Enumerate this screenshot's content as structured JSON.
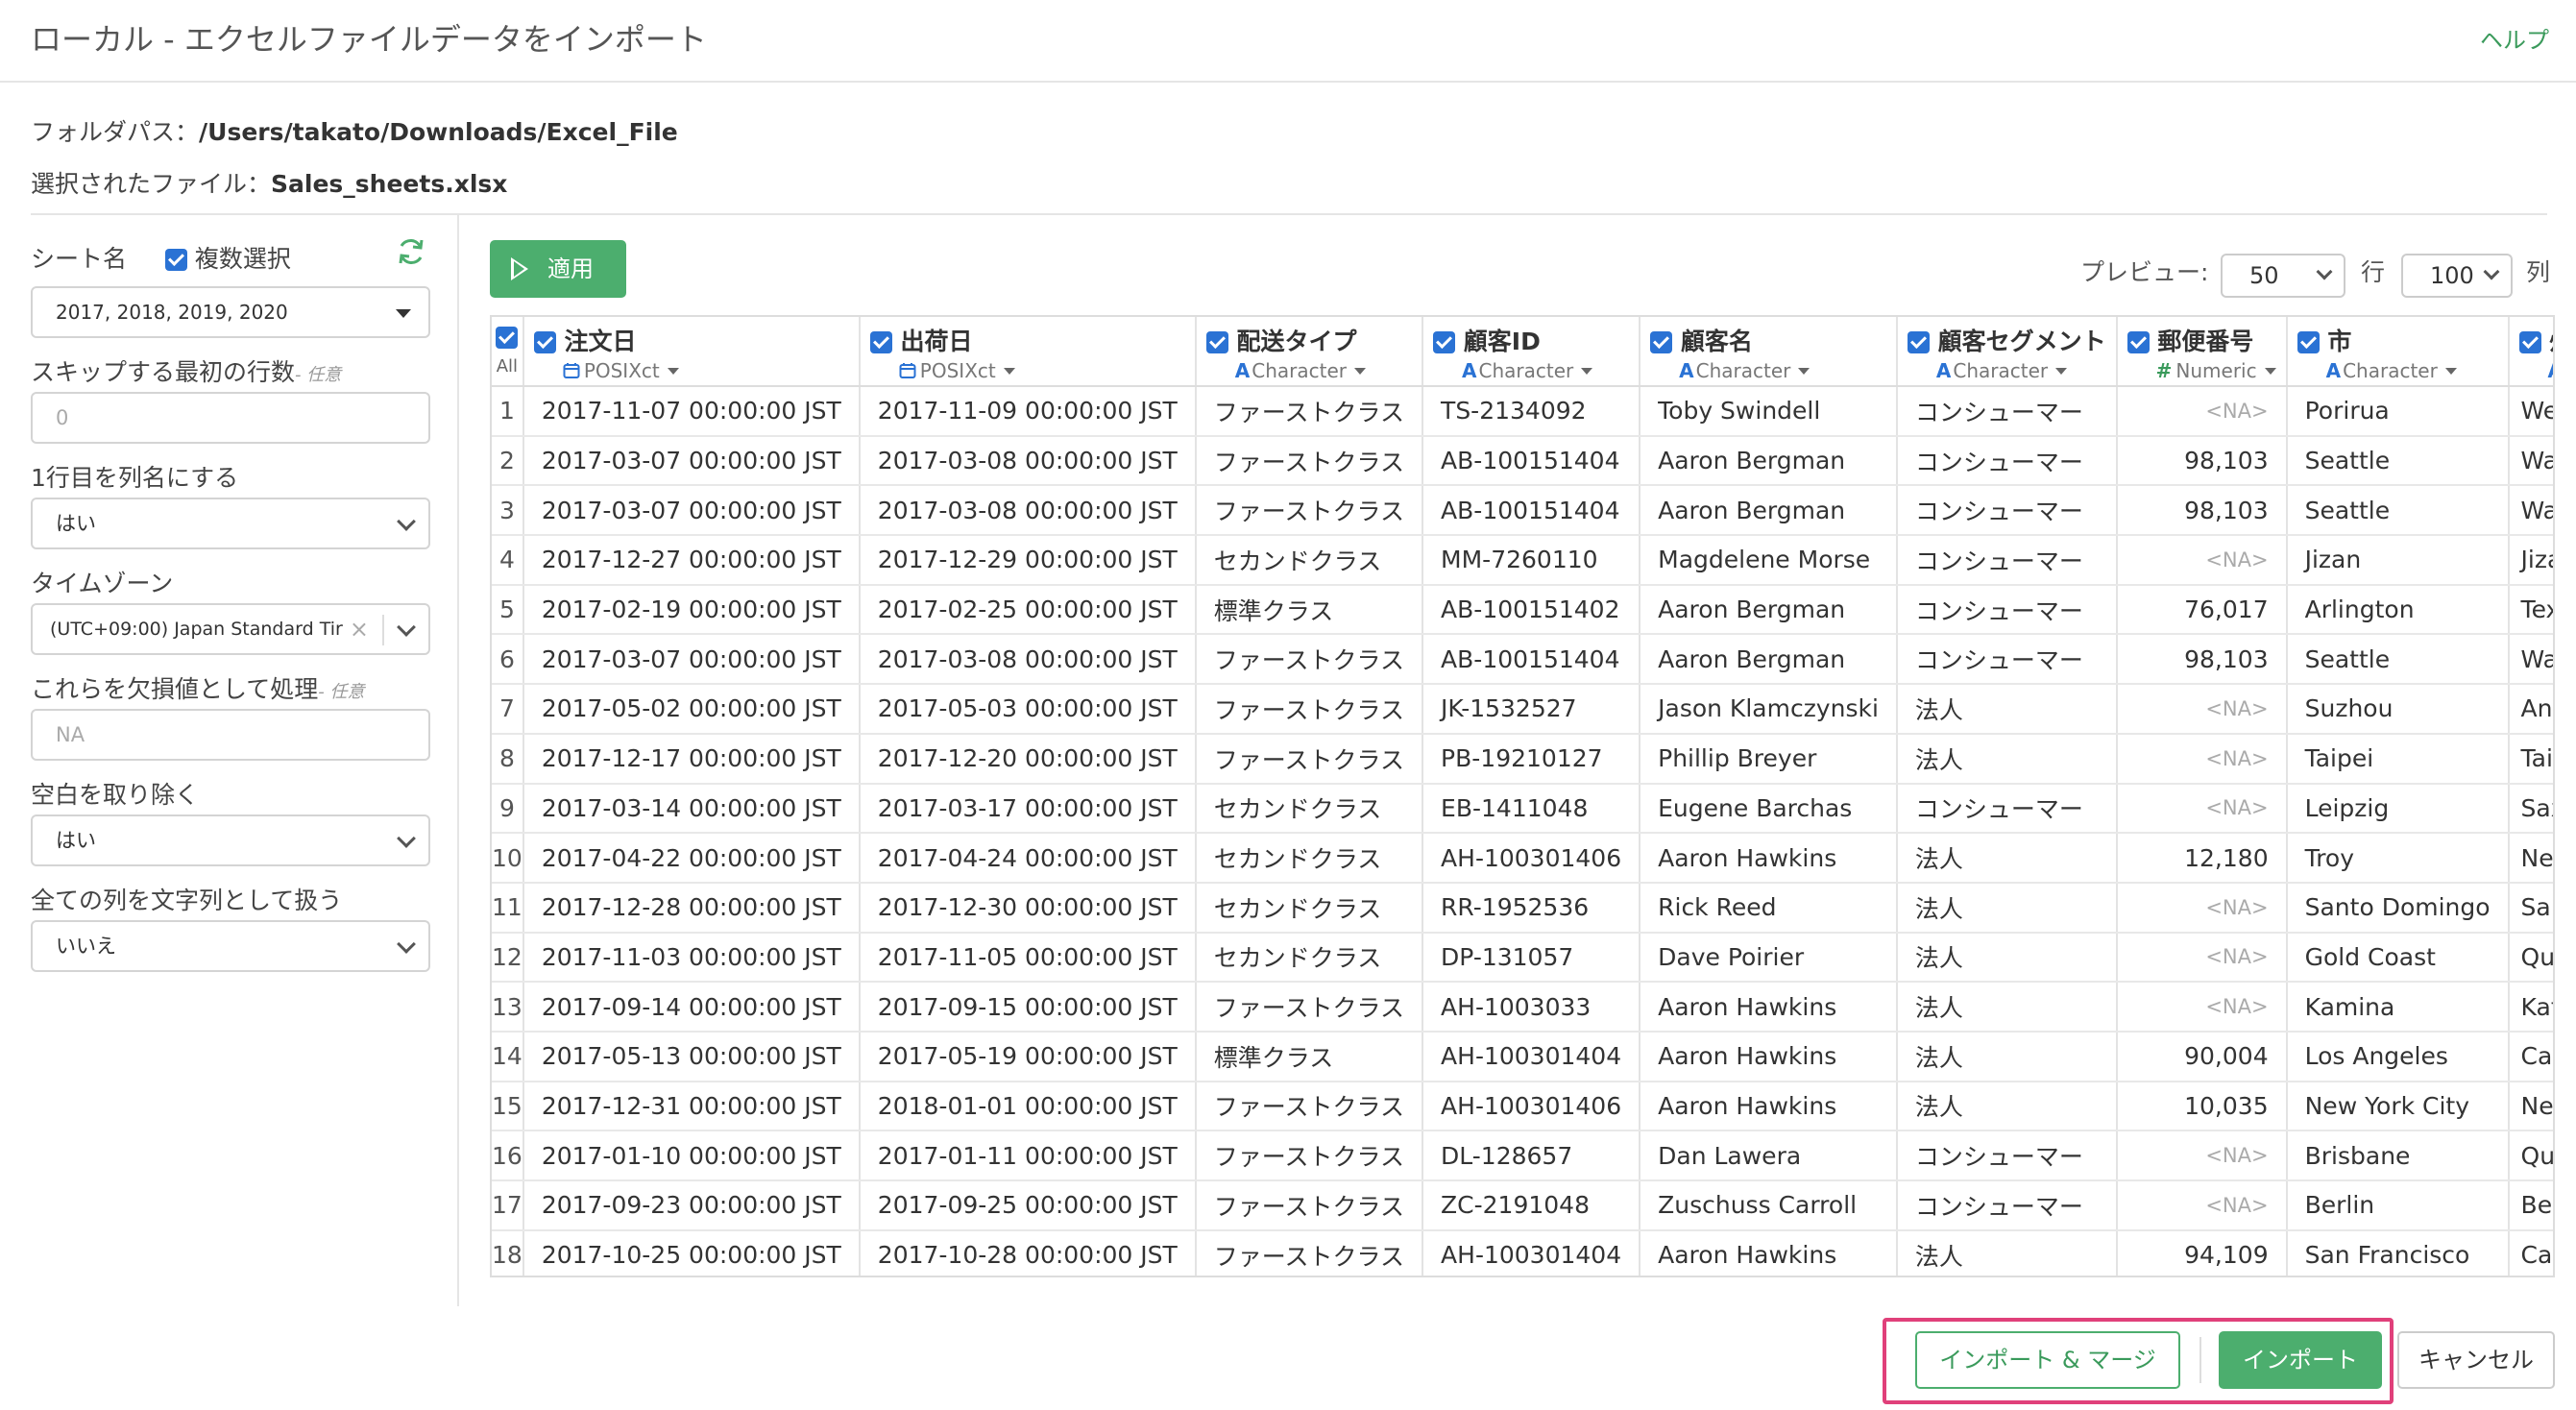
{
  "header": {
    "title": "ローカル - エクセルファイルデータをインポート",
    "help": "ヘルプ"
  },
  "info": {
    "folder_label": "フォルダパス：",
    "folder_value": "/Users/takato/Downloads/Excel_File",
    "file_label": "選択されたファイル：",
    "file_value": "Sales_sheets.xlsx"
  },
  "sidebar": {
    "sheet_label": "シート名",
    "multi_select_label": "複数選択",
    "sheet_value": "2017, 2018, 2019, 2020",
    "skip_label": "スキップする最初の行数",
    "optional": "- 任意",
    "skip_placeholder": "0",
    "header_label": "1行目を列名にする",
    "header_value": "はい",
    "timezone_label": "タイムゾーン",
    "timezone_value": "(UTC+09:00) Japan Standard Tir",
    "na_label": "これらを欠損値として処理",
    "na_placeholder": "NA",
    "trim_label": "空白を取り除く",
    "trim_value": "はい",
    "as_string_label": "全ての列を文字列として扱う",
    "as_string_value": "いいえ"
  },
  "toolbar": {
    "apply_label": "適用",
    "preview_label": "プレビュー:",
    "rows_value": "50",
    "rows_unit": "行",
    "cols_value": "100",
    "cols_unit": "列"
  },
  "table": {
    "all_label": "All",
    "columns": [
      {
        "name": "注文日",
        "type": "POSIXct",
        "icon": "calendar-icon"
      },
      {
        "name": "出荷日",
        "type": "POSIXct",
        "icon": "calendar-icon"
      },
      {
        "name": "配送タイプ",
        "type": "Character",
        "icon": "A"
      },
      {
        "name": "顧客ID",
        "type": "Character",
        "icon": "A"
      },
      {
        "name": "顧客名",
        "type": "Character",
        "icon": "A"
      },
      {
        "name": "顧客セグメント",
        "type": "Character",
        "icon": "A"
      },
      {
        "name": "郵便番号",
        "type": "Numeric",
        "icon": "#"
      },
      {
        "name": "市",
        "type": "Character",
        "icon": "A"
      },
      {
        "name": "州",
        "type": "C",
        "icon": "A"
      }
    ],
    "rows": [
      [
        "1",
        "2017-11-07 00:00:00 JST",
        "2017-11-09 00:00:00 JST",
        "ファーストクラス",
        "TS-2134092",
        "Toby Swindell",
        "コンシューマー",
        "<NA>",
        "Porirua",
        "Welli"
      ],
      [
        "2",
        "2017-03-07 00:00:00 JST",
        "2017-03-08 00:00:00 JST",
        "ファーストクラス",
        "AB-100151404",
        "Aaron Bergman",
        "コンシューマー",
        "98,103",
        "Seattle",
        "Was"
      ],
      [
        "3",
        "2017-03-07 00:00:00 JST",
        "2017-03-08 00:00:00 JST",
        "ファーストクラス",
        "AB-100151404",
        "Aaron Bergman",
        "コンシューマー",
        "98,103",
        "Seattle",
        "Was"
      ],
      [
        "4",
        "2017-12-27 00:00:00 JST",
        "2017-12-29 00:00:00 JST",
        "セカンドクラス",
        "MM-7260110",
        "Magdelene Morse",
        "コンシューマー",
        "<NA>",
        "Jizan",
        "Jizar"
      ],
      [
        "5",
        "2017-02-19 00:00:00 JST",
        "2017-02-25 00:00:00 JST",
        "標準クラス",
        "AB-100151402",
        "Aaron Bergman",
        "コンシューマー",
        "76,017",
        "Arlington",
        "Texa"
      ],
      [
        "6",
        "2017-03-07 00:00:00 JST",
        "2017-03-08 00:00:00 JST",
        "ファーストクラス",
        "AB-100151404",
        "Aaron Bergman",
        "コンシューマー",
        "98,103",
        "Seattle",
        "Was"
      ],
      [
        "7",
        "2017-05-02 00:00:00 JST",
        "2017-05-03 00:00:00 JST",
        "ファーストクラス",
        "JK-1532527",
        "Jason Klamczynski",
        "法人",
        "<NA>",
        "Suzhou",
        "Anhu"
      ],
      [
        "8",
        "2017-12-17 00:00:00 JST",
        "2017-12-20 00:00:00 JST",
        "ファーストクラス",
        "PB-19210127",
        "Phillip Breyer",
        "法人",
        "<NA>",
        "Taipei",
        "Taipe"
      ],
      [
        "9",
        "2017-03-14 00:00:00 JST",
        "2017-03-17 00:00:00 JST",
        "セカンドクラス",
        "EB-1411048",
        "Eugene Barchas",
        "コンシューマー",
        "<NA>",
        "Leipzig",
        "Saxo"
      ],
      [
        "10",
        "2017-04-22 00:00:00 JST",
        "2017-04-24 00:00:00 JST",
        "セカンドクラス",
        "AH-100301406",
        "Aaron Hawkins",
        "法人",
        "12,180",
        "Troy",
        "New"
      ],
      [
        "11",
        "2017-12-28 00:00:00 JST",
        "2017-12-30 00:00:00 JST",
        "セカンドクラス",
        "RR-1952536",
        "Rick Reed",
        "法人",
        "<NA>",
        "Santo Domingo",
        "Sant"
      ],
      [
        "12",
        "2017-11-03 00:00:00 JST",
        "2017-11-05 00:00:00 JST",
        "セカンドクラス",
        "DP-131057",
        "Dave Poirier",
        "法人",
        "<NA>",
        "Gold Coast",
        "Quee"
      ],
      [
        "13",
        "2017-09-14 00:00:00 JST",
        "2017-09-15 00:00:00 JST",
        "ファーストクラス",
        "AH-1003033",
        "Aaron Hawkins",
        "法人",
        "<NA>",
        "Kamina",
        "Kata"
      ],
      [
        "14",
        "2017-05-13 00:00:00 JST",
        "2017-05-19 00:00:00 JST",
        "標準クラス",
        "AH-100301404",
        "Aaron Hawkins",
        "法人",
        "90,004",
        "Los Angeles",
        "Calif"
      ],
      [
        "15",
        "2017-12-31 00:00:00 JST",
        "2018-01-01 00:00:00 JST",
        "ファーストクラス",
        "AH-100301406",
        "Aaron Hawkins",
        "法人",
        "10,035",
        "New York City",
        "New"
      ],
      [
        "16",
        "2017-01-10 00:00:00 JST",
        "2017-01-11 00:00:00 JST",
        "ファーストクラス",
        "DL-128657",
        "Dan Lawera",
        "コンシューマー",
        "<NA>",
        "Brisbane",
        "Quee"
      ],
      [
        "17",
        "2017-09-23 00:00:00 JST",
        "2017-09-25 00:00:00 JST",
        "ファーストクラス",
        "ZC-2191048",
        "Zuschuss Carroll",
        "コンシューマー",
        "<NA>",
        "Berlin",
        "Berli"
      ],
      [
        "18",
        "2017-10-25 00:00:00 JST",
        "2017-10-28 00:00:00 JST",
        "ファーストクラス",
        "AH-100301404",
        "Aaron Hawkins",
        "法人",
        "94,109",
        "San Francisco",
        "Calif"
      ]
    ]
  },
  "footer": {
    "import_merge_label": "インポート & マージ",
    "import_label": "インポート",
    "cancel_label": "キャンセル"
  },
  "colors": {
    "accent": "#4cae6e",
    "checkbox": "#2a72d4",
    "highlight": "#e0407a"
  }
}
